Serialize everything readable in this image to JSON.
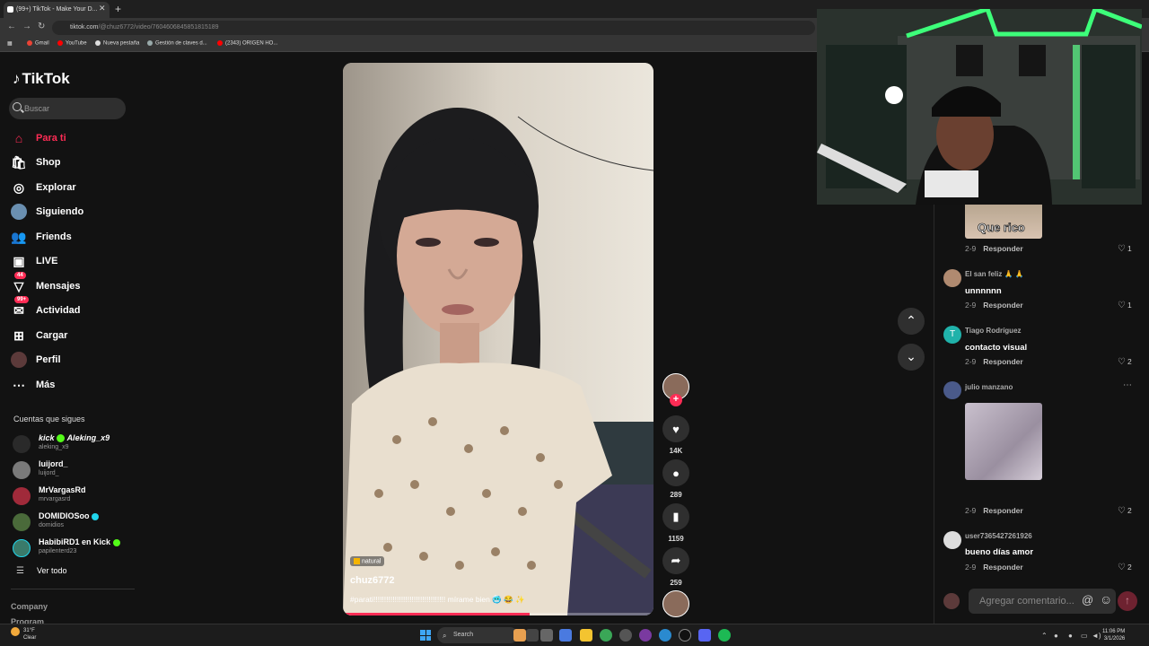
{
  "browser": {
    "tab_title": "(99+) TikTok - Make Your D...",
    "url_host": "tiktok.com",
    "url_path": "/@chuz6772/video/7604606845851815189",
    "bookmarks": [
      "Gmail",
      "YouTube",
      "Nueva pestaña",
      "Gestión de claves d...",
      "(2343) ORIGEN HO..."
    ]
  },
  "sidebar": {
    "logo": "TikTok",
    "search_placeholder": "Buscar",
    "nav": [
      {
        "label": "Para ti",
        "icon": "home-icon"
      },
      {
        "label": "Shop",
        "icon": "shop-icon"
      },
      {
        "label": "Explorar",
        "icon": "compass-icon"
      },
      {
        "label": "Siguiendo",
        "icon": "following-icon"
      },
      {
        "label": "Friends",
        "icon": "friends-icon"
      },
      {
        "label": "LIVE",
        "icon": "live-icon"
      },
      {
        "label": "Mensajes",
        "icon": "messages-icon",
        "badge": "44"
      },
      {
        "label": "Actividad",
        "icon": "activity-icon",
        "badge": "99+"
      },
      {
        "label": "Cargar",
        "icon": "upload-icon"
      },
      {
        "label": "Perfil",
        "icon": "profile-icon"
      },
      {
        "label": "Más",
        "icon": "more-icon"
      }
    ],
    "follows_title": "Cuentas que sigues",
    "follows": [
      {
        "name": "kick",
        "extra": "Aleking_x9",
        "handle": "aleking_x9"
      },
      {
        "name": "luijord_",
        "handle": "luijord_"
      },
      {
        "name": "MrVargasRd",
        "handle": "mrvargasrd"
      },
      {
        "name": "DOMIDIOSoo",
        "handle": "domidios"
      },
      {
        "name": "HabibiRD1 en Kick",
        "handle": "papilenterd23"
      }
    ],
    "see_all": "Ver todo",
    "company": "Company",
    "program": "Program"
  },
  "video": {
    "tag": "natural",
    "author": "chuz6772",
    "caption": "#parati!!!!!!!!!!!!!!!!!!!!!!!!!!!!!!!!!! mírame bien 🥶 😂 ✨",
    "progress": 0.6
  },
  "actions": {
    "likes": "14K",
    "comments": "289",
    "saves": "1159",
    "shares": "259"
  },
  "comments": {
    "items": [
      {
        "name": "",
        "text": "",
        "sticker": "Que rico",
        "date": "2-9",
        "likes": "1"
      },
      {
        "name": "El san feliz 🙏 🙏",
        "text": "unnnnnn",
        "date": "2-9",
        "likes": "1"
      },
      {
        "name": "Tiago Rodríguez",
        "text": "contacto visual",
        "date": "2-9",
        "likes": "2",
        "initial": "T"
      },
      {
        "name": "julio manzano",
        "text": "",
        "date": "2-9",
        "likes": "2"
      },
      {
        "name": "user7365427261926",
        "text": "bueno días amor",
        "date": "2-9",
        "likes": "2"
      }
    ],
    "reply_label": "Responder",
    "input_placeholder": "Agregar comentario...",
    "more": "⋯"
  },
  "taskbar": {
    "weather_temp": "31°F",
    "weather_desc": "Clear",
    "search": "Search",
    "time": "11:06 PM",
    "date": "3/1/2026"
  },
  "colors": {
    "accent": "#fe2c55",
    "background": "#121212",
    "verified": "#20d5ec"
  }
}
